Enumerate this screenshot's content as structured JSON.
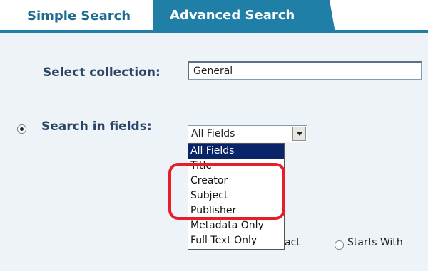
{
  "tabs": {
    "simple": "Simple Search",
    "advanced": "Advanced Search"
  },
  "collection": {
    "label": "Select collection:",
    "value": "General"
  },
  "fields": {
    "label": "Search in fields:",
    "selected": "All Fields",
    "options": [
      "All Fields",
      "Title",
      "Creator",
      "Subject",
      "Publisher",
      "Metadata Only",
      "Full Text Only"
    ]
  },
  "match": {
    "exact_partial": "act",
    "starts_with": "Starts With"
  },
  "colors": {
    "tab_active": "#1f7fa6",
    "link": "#1d6c8e",
    "highlight": "#e51e2a",
    "panel": "#eef3f7"
  }
}
